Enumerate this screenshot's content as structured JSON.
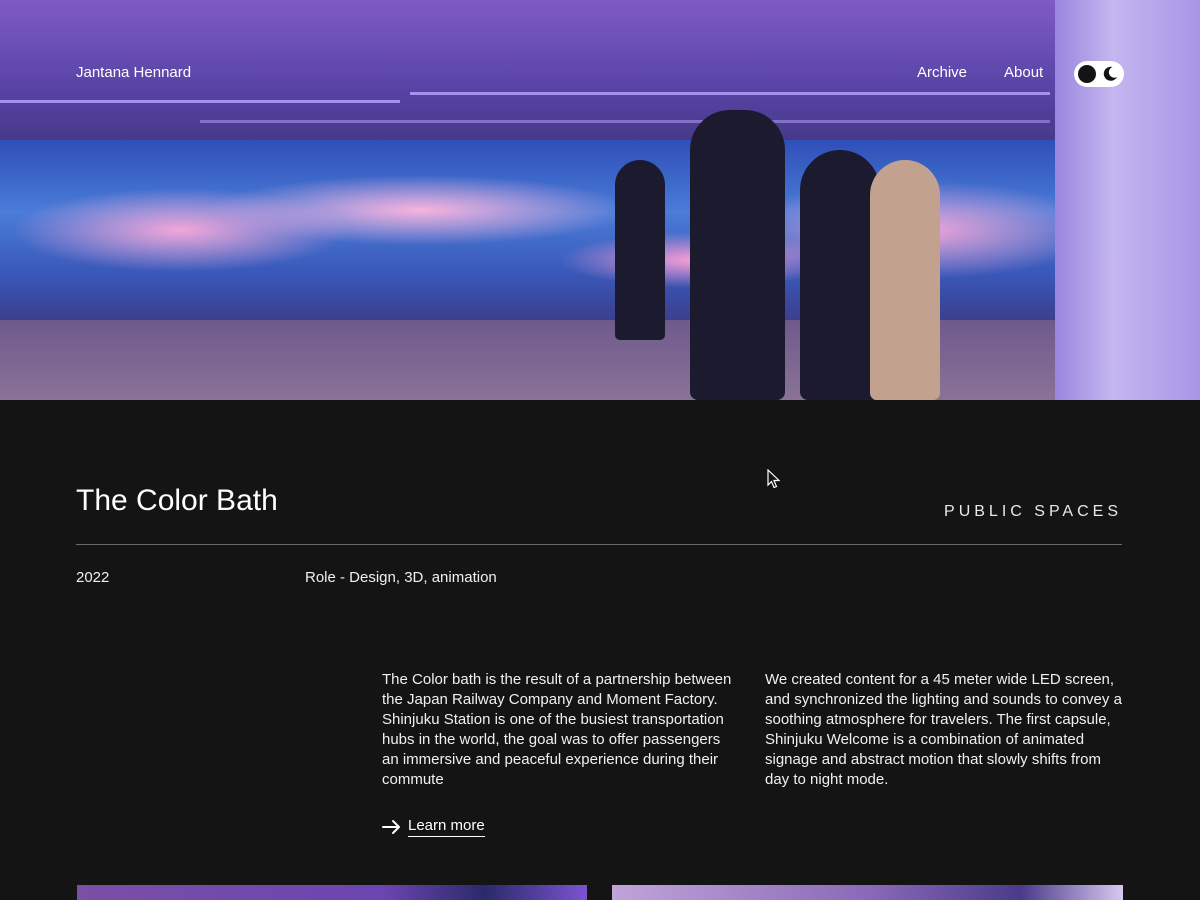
{
  "header": {
    "site_name": "Jantana Hennard",
    "nav": [
      {
        "label": "Archive"
      },
      {
        "label": "About"
      }
    ],
    "theme_toggle": {
      "icon": "moon-icon",
      "state": "dark"
    }
  },
  "hero": {
    "image": "station-led-wall-photo"
  },
  "project": {
    "title": "The Color Bath",
    "category": "PUBLIC SPACES",
    "year": "2022",
    "role": "Role - Design, 3D, animation",
    "description_left": "The Color bath is the result of a partnership between the Japan Railway Company and Moment Factory. Shinjuku Station is one of the busiest transportation hubs in the world, the goal was to offer passengers an immersive and peaceful experience during their commute",
    "description_right": "We created content for a 45 meter wide LED screen, and synchronized the lighting and sounds to convey a soothing atmosphere for travelers. The first capsule, Shinjuku Welcome is a combination of animated signage and abstract motion that slowly shifts from day to night mode.",
    "learn_more_label": "Learn more"
  },
  "colors": {
    "background": "#141414",
    "text": "#f0f0f0"
  }
}
